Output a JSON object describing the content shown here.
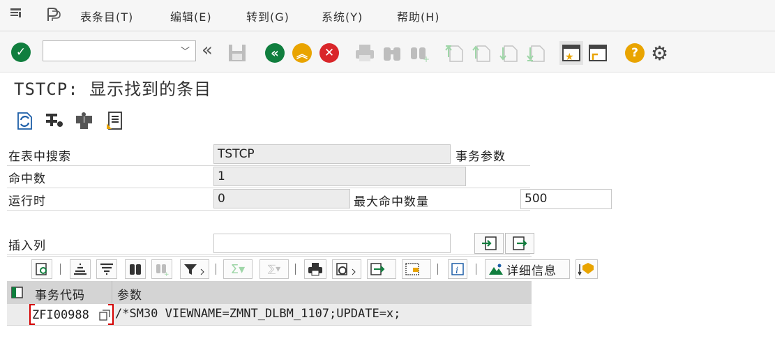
{
  "menu": {
    "items": [
      "表条目(T)",
      "编辑(E)",
      "转到(G)",
      "系统(Y)",
      "帮助(H)"
    ]
  },
  "toolbar": {
    "command_field_value": "",
    "icons": [
      "enter-icon",
      "command-field",
      "collapse-icon",
      "save-icon",
      "back-icon",
      "exit-icon",
      "cancel-icon",
      "print-icon",
      "find-icon",
      "find-next-icon",
      "first-page-icon",
      "previous-page-icon",
      "next-page-icon",
      "last-page-icon",
      "create-session-icon",
      "shortcut-icon",
      "help-icon",
      "settings-icon"
    ]
  },
  "page": {
    "title": "TSTCP: 显示找到的条目"
  },
  "app_toolbar": {
    "icons": [
      "refresh-icon",
      "check-table-icon",
      "puzzle-icon",
      "export-icon"
    ]
  },
  "form": {
    "search_table_label": "在表中搜索",
    "search_table_value": "TSTCP",
    "search_table_desc": "事务参数",
    "hits_label": "命中数",
    "hits_value": "1",
    "runtime_label": "运行时",
    "runtime_value": "0",
    "max_hits_label": "最大命中数量",
    "max_hits_value": "500",
    "insert_col_label": "插入列",
    "insert_col_value": ""
  },
  "alv": {
    "detail_label": "详细信息",
    "columns": [
      "事务代码",
      "参数"
    ],
    "rows": [
      {
        "tcode": "ZFI00988",
        "param": "/*SM30 VIEWNAME=ZMNT_DLBM_1107;UPDATE=x;"
      }
    ]
  },
  "colors": {
    "green": "#107e3e",
    "orange": "#e9a400",
    "red": "#d9262a",
    "bg": "#f6f6f6",
    "selection": "#d40000"
  }
}
